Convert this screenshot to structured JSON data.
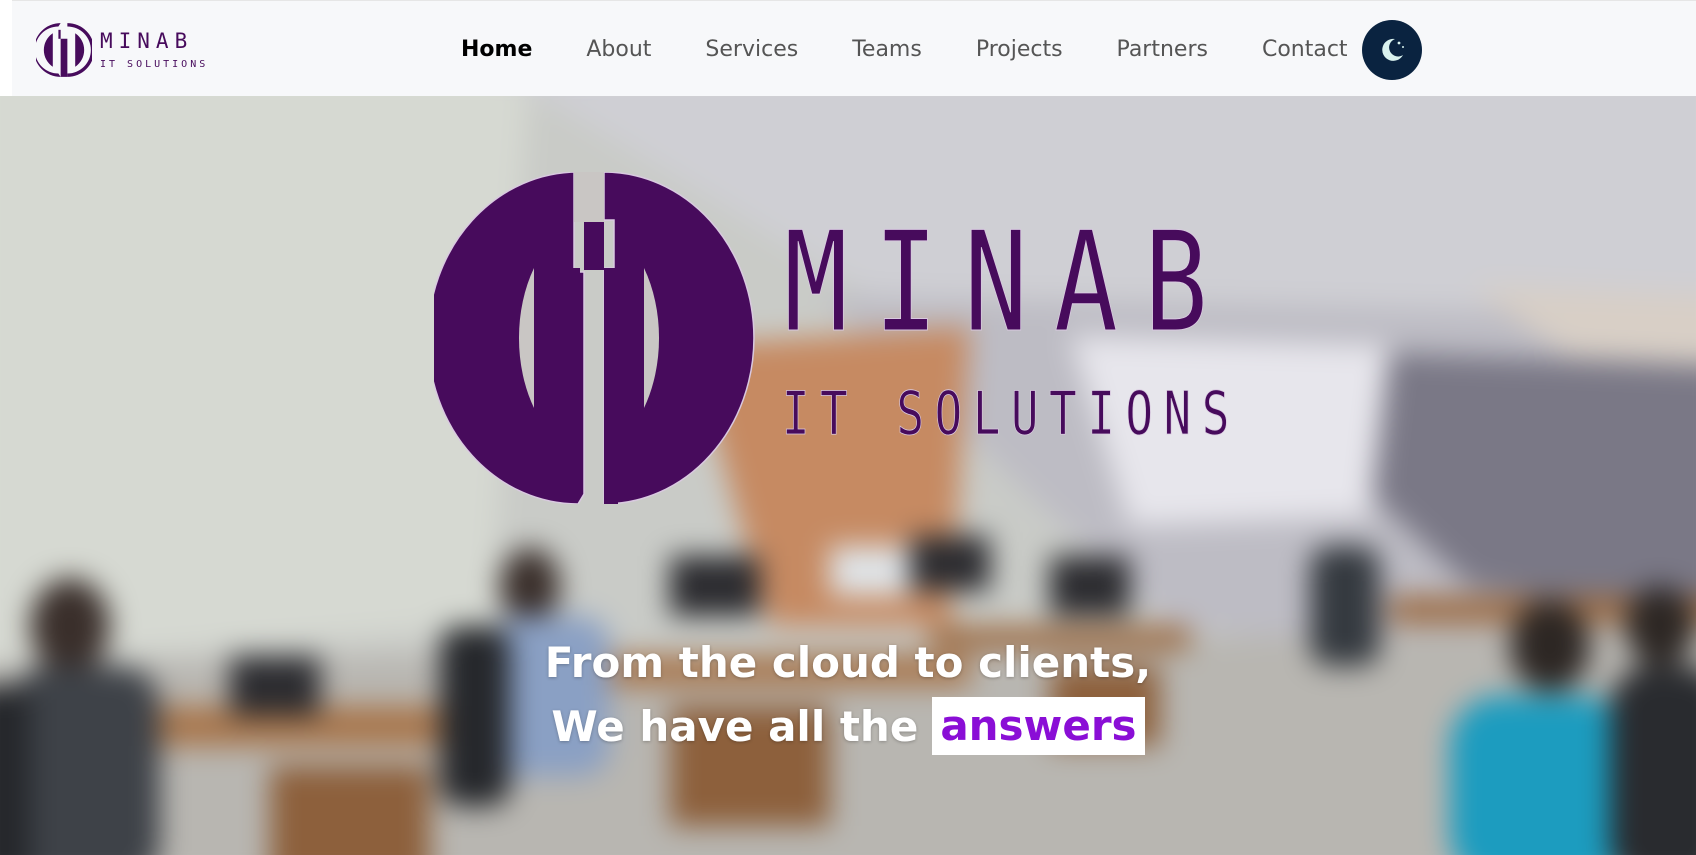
{
  "brand": {
    "name": "MINAB",
    "subtitle": "IT SOLUTIONS"
  },
  "nav": {
    "items": [
      {
        "label": "Home",
        "active": true
      },
      {
        "label": "About",
        "active": false
      },
      {
        "label": "Services",
        "active": false
      },
      {
        "label": "Teams",
        "active": false
      },
      {
        "label": "Projects",
        "active": false
      },
      {
        "label": "Partners",
        "active": false
      },
      {
        "label": "Contact",
        "active": false
      }
    ],
    "theme_toggle_icon": "moon-icon"
  },
  "hero": {
    "logo_name": "MINAB",
    "logo_subtitle": "IT SOLUTIONS",
    "tagline_line1": "From the cloud to clients,",
    "tagline_line2": "We have all the",
    "tagline_highlight": "answers",
    "background": "blurred office photo"
  },
  "colors": {
    "brand_purple": "#470b5c",
    "highlight_purple": "#8a0ed6",
    "toggle_bg": "#0a2340",
    "moon": "#d9f2ee",
    "nav_bg": "#f7f8fa"
  }
}
